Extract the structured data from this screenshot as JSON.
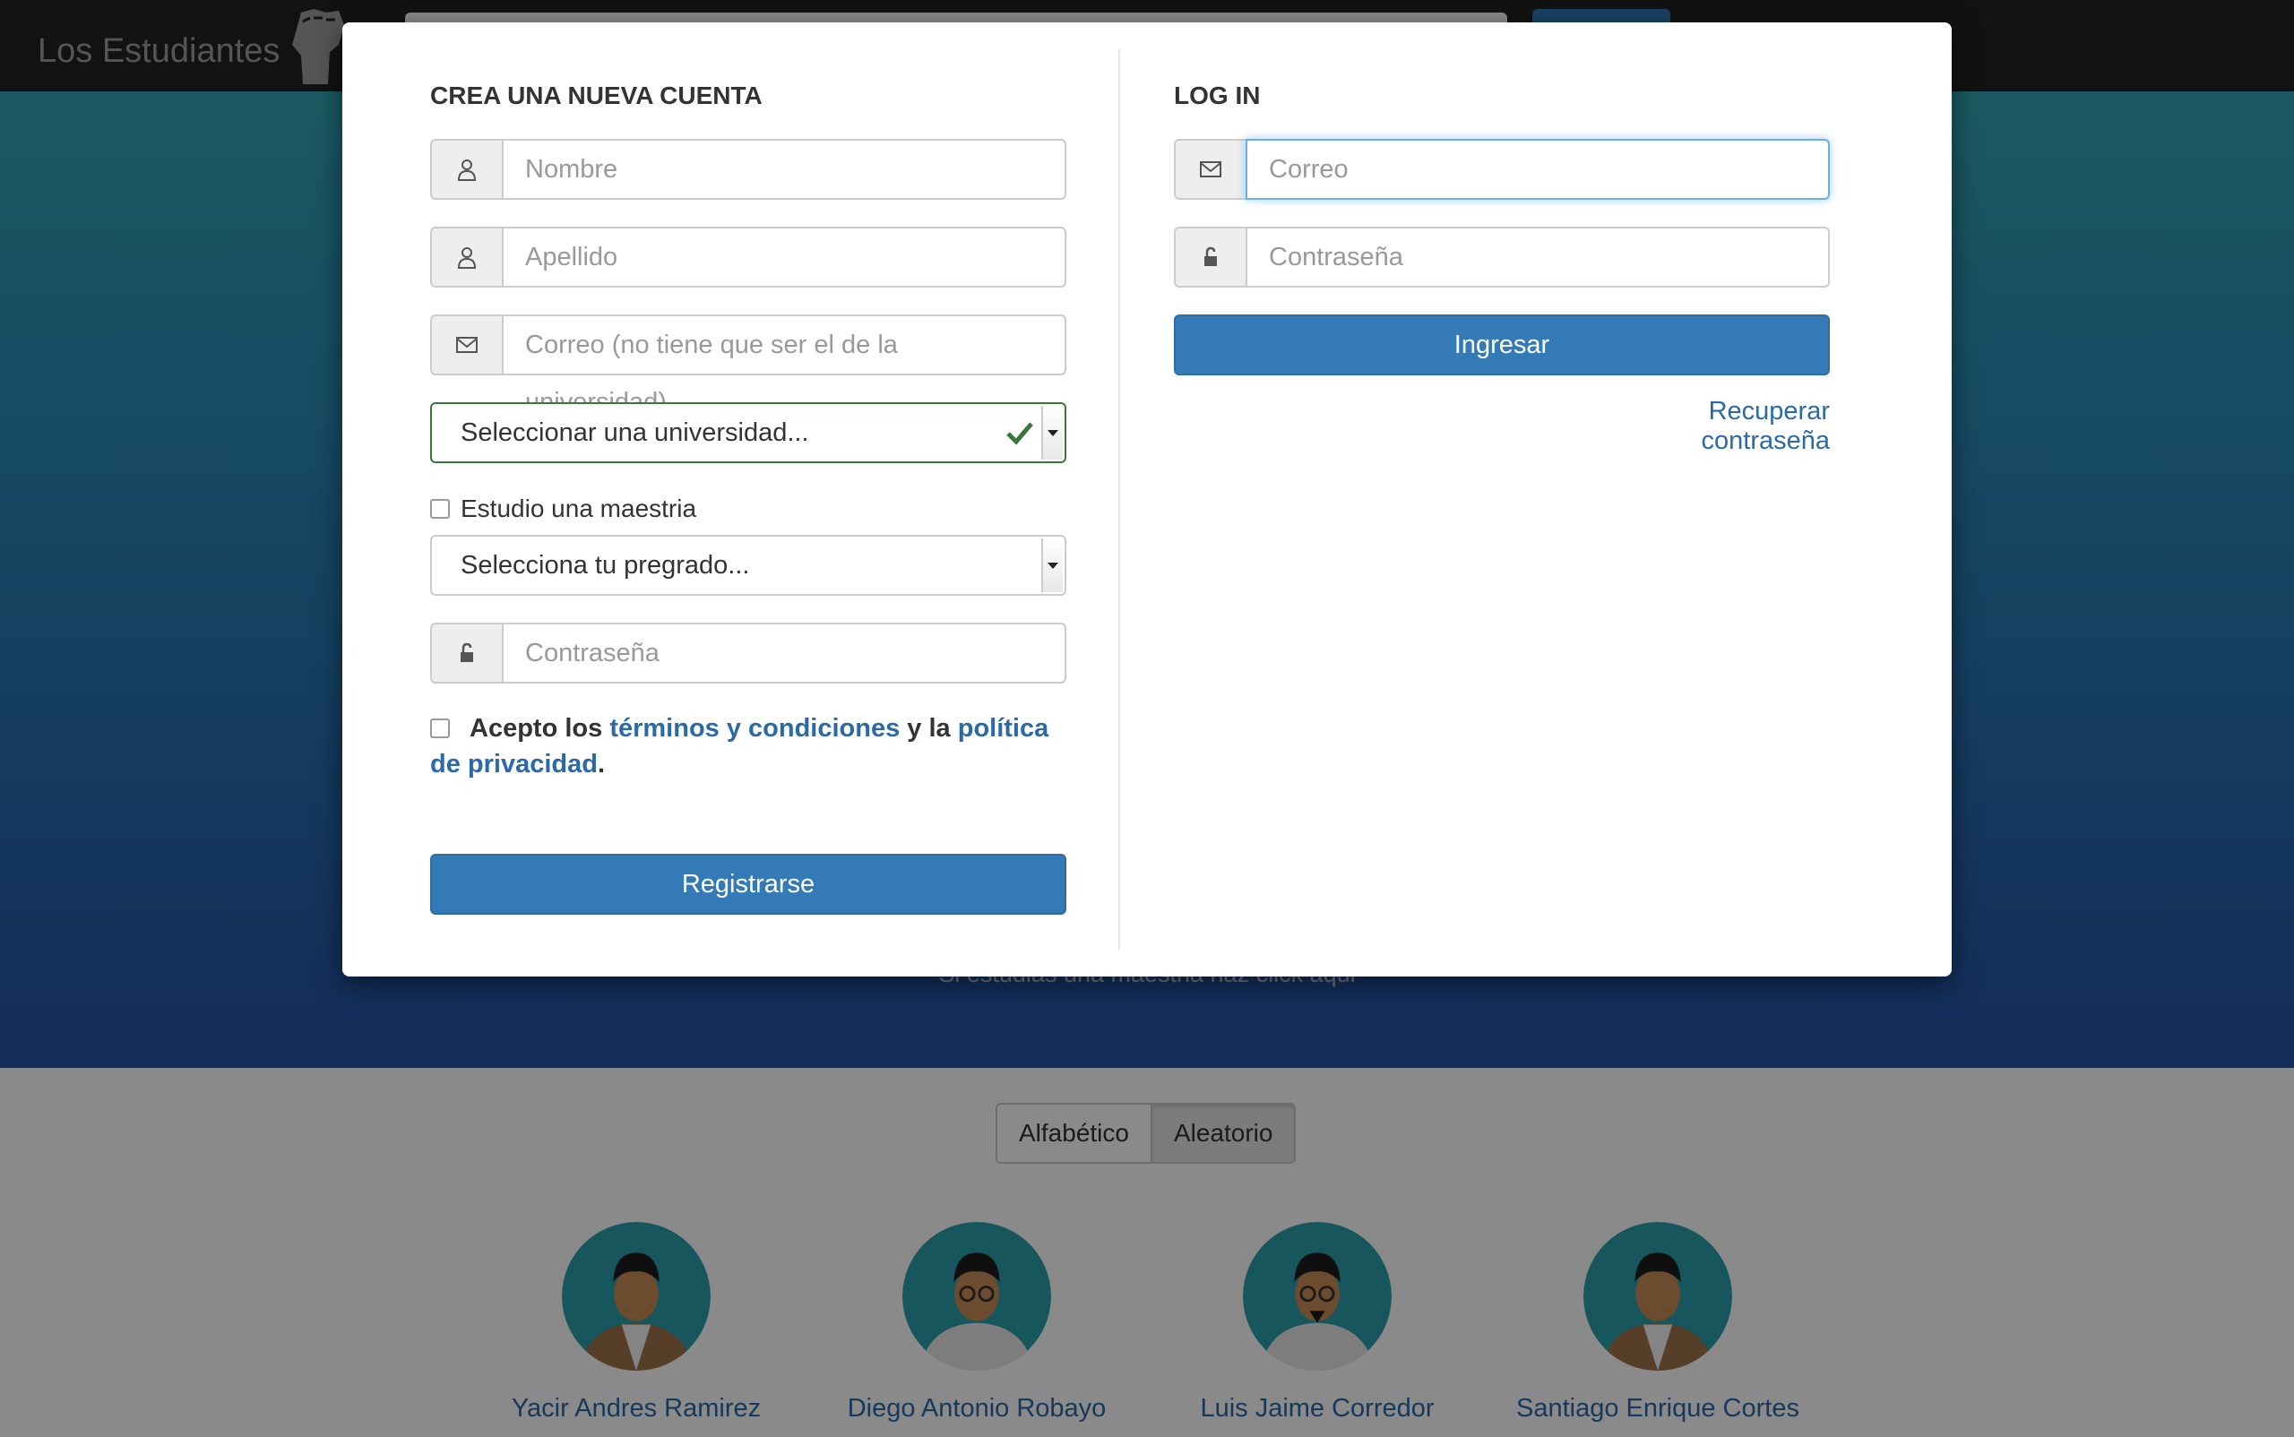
{
  "navbar": {
    "brand": "Los Estudiantes"
  },
  "hero": {
    "master_link": "Si estudias una maestria haz click aqui"
  },
  "sort": {
    "alphabetic": "Alfabético",
    "random": "Aleatorio"
  },
  "students": [
    {
      "name": "Yacir Andres Ramirez"
    },
    {
      "name": "Diego Antonio Robayo"
    },
    {
      "name": "Luis Jaime Corredor"
    },
    {
      "name": "Santiago Enrique Cortes"
    }
  ],
  "modal": {
    "register": {
      "title": "CREA UNA NUEVA CUENTA",
      "first_name_placeholder": "Nombre",
      "last_name_placeholder": "Apellido",
      "email_placeholder": "Correo (no tiene que ser el de la universidad)",
      "university_select": "Seleccionar una universidad...",
      "master_checkbox_label": "Estudio una maestria",
      "program_select": "Selecciona tu pregrado...",
      "password_placeholder": "Contraseña",
      "terms_prefix": "Acepto los ",
      "terms_link": "términos y condiciones",
      "terms_middle": " y la ",
      "privacy_link": "política de privacidad",
      "terms_suffix": ".",
      "submit": "Registrarse"
    },
    "login": {
      "title": "LOG IN",
      "email_placeholder": "Correo",
      "password_placeholder": "Contraseña",
      "submit": "Ingresar",
      "recover_link": "Recuperar contraseña"
    }
  },
  "colors": {
    "primary": "#337ab7",
    "link": "#2a6aa8",
    "valid": "#3c763d",
    "navbar": "#222222"
  }
}
